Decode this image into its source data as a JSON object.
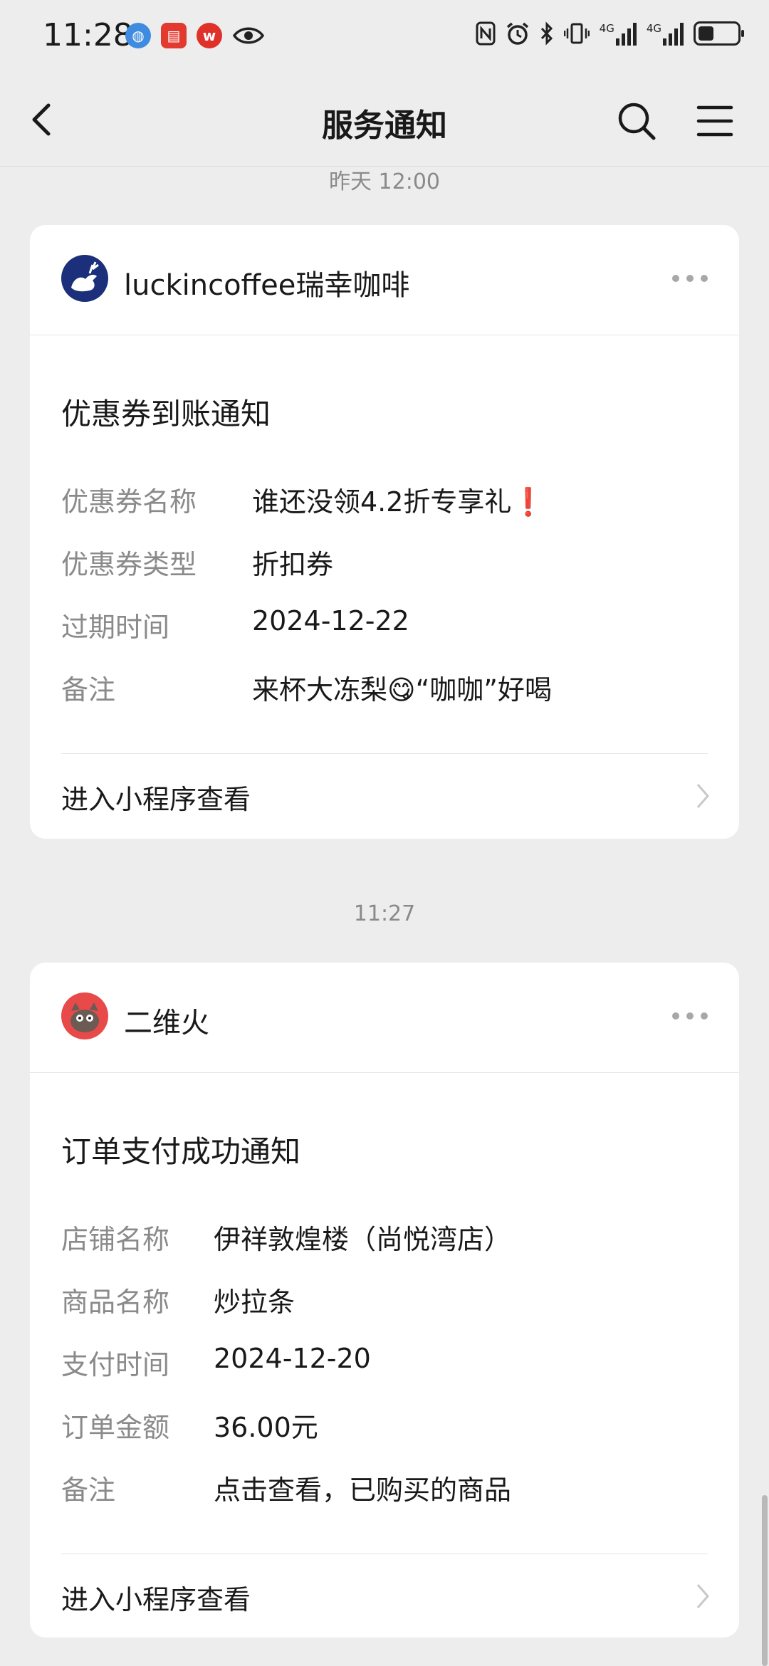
{
  "status_bar": {
    "time": "11:28",
    "network_1": "4G",
    "network_2": "4G",
    "battery_level": 0.4
  },
  "header": {
    "title": "服务通知",
    "back_icon": "back-chevron-icon",
    "search_icon": "search-icon",
    "menu_icon": "menu-icon"
  },
  "messages": [
    {
      "timestamp": "昨天 12:00",
      "sender": "luckincoffee瑞幸咖啡",
      "title": "优惠券到账通知",
      "fields": [
        {
          "key": "优惠券名称",
          "value": "谁还没领4.2折专享礼❗"
        },
        {
          "key": "优惠券类型",
          "value": "折扣券"
        },
        {
          "key": "过期时间",
          "value": "2024-12-22"
        },
        {
          "key": "备注",
          "value": "来杯大冻梨😋“咖咖”好喝"
        }
      ],
      "link_label": "进入小程序查看"
    },
    {
      "timestamp": "11:27",
      "sender": "二维火",
      "title": "订单支付成功通知",
      "fields": [
        {
          "key": "店铺名称",
          "value": "伊祥敦煌楼（尚悦湾店）"
        },
        {
          "key": "商品名称",
          "value": "炒拉条"
        },
        {
          "key": "支付时间",
          "value": "2024-12-20"
        },
        {
          "key": "订单金额",
          "value": "36.00元"
        },
        {
          "key": "备注",
          "value": "点击查看，已购买的商品"
        }
      ],
      "link_label": "进入小程序查看"
    }
  ],
  "colors": {
    "background": "#ededed",
    "card": "#ffffff",
    "label_gray": "#8a8a8a",
    "luckin_blue": "#1b2f7a"
  }
}
